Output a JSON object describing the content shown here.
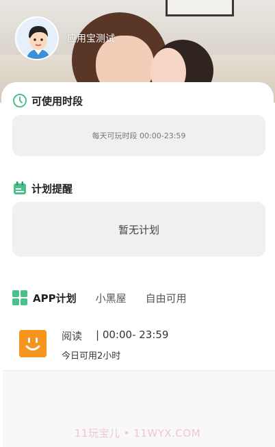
{
  "header": {
    "username": "应用宝测试"
  },
  "usable_time": {
    "title": "可使用时段",
    "daily_playable": "每天可玩时段  00:00-23:59"
  },
  "plan_reminder": {
    "title": "计划提醒",
    "empty": "暂无计划"
  },
  "tabs": [
    {
      "label": "APP计划"
    },
    {
      "label": "小黑屋"
    },
    {
      "label": "自由可用"
    }
  ],
  "apps": [
    {
      "name": "阅读",
      "time_range": "| 00:00- 23:59",
      "usage": "今日可用2小时",
      "icon_color": "#f7941d"
    }
  ],
  "watermark": "11玩宝儿 • 11WYX.COM",
  "colors": {
    "accent": "#4dbf8a",
    "app_icon": "#f7941d"
  }
}
